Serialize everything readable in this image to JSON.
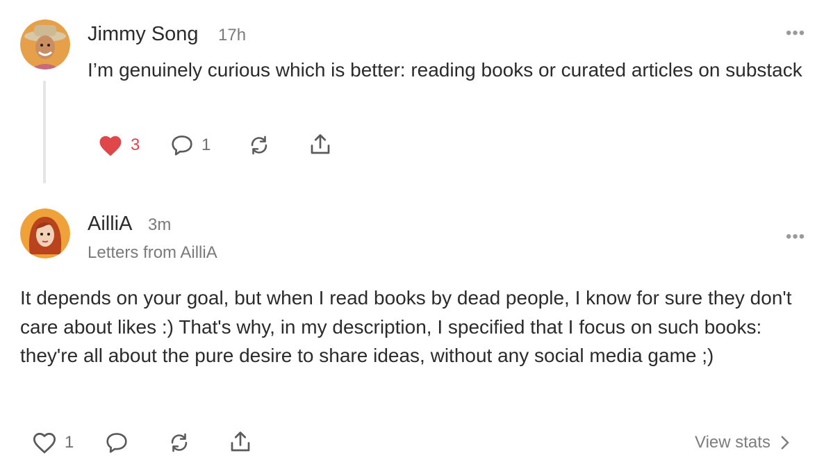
{
  "post1": {
    "author": "Jimmy Song",
    "time": "17h",
    "text": "I’m genuinely curious which is better: reading books or curated articles on substack",
    "like_count": "3",
    "comment_count": "1",
    "menu_label": "•••",
    "icons": [
      "avatar-jimmy",
      "heart-filled-icon",
      "comment-icon",
      "restack-icon",
      "share-icon"
    ],
    "accent_color": "#e0474b"
  },
  "post2": {
    "author": "AilliA",
    "time": "3m",
    "publication": "Letters from AilliA",
    "text": "It depends on your goal, but when I read books by dead people, I know for sure they don't care about likes :) That's why, in my description, I specified that I focus on such books: they're all about the pure desire to share ideas, without any social media game ;)",
    "like_count": "1",
    "view_stats_label": "View stats",
    "menu_label": "•••",
    "icons": [
      "avatar-aillia",
      "heart-outline-icon",
      "comment-icon",
      "restack-icon",
      "share-icon",
      "chevron-right-icon"
    ]
  }
}
